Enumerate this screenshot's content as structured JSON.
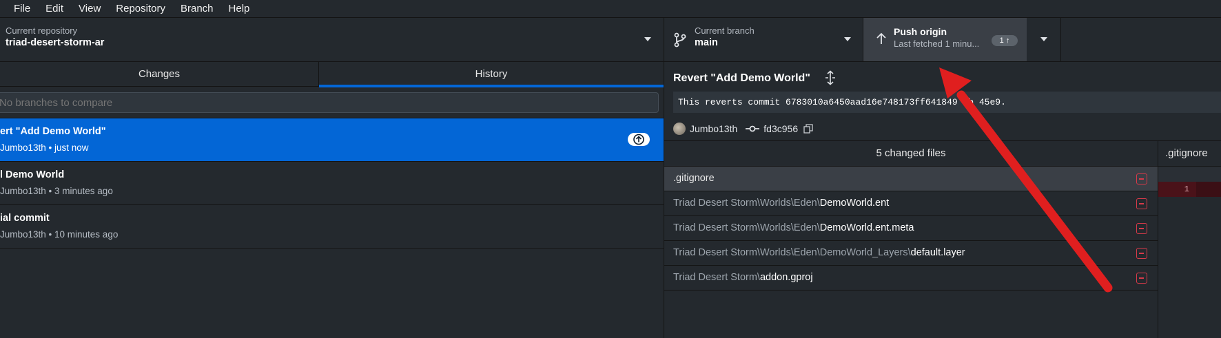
{
  "menu": {
    "items": [
      "File",
      "Edit",
      "View",
      "Repository",
      "Branch",
      "Help"
    ]
  },
  "toolbar": {
    "repo_label": "Current repository",
    "repo_name": "triad-desert-storm-ar",
    "branch_label": "Current branch",
    "branch_name": "main",
    "push_title": "Push origin",
    "push_sub": "Last fetched 1 minu...",
    "push_count": "1 ↑"
  },
  "tabs": {
    "changes": "Changes",
    "history": "History"
  },
  "compare": {
    "placeholder": "No branches to compare"
  },
  "commits": [
    {
      "title": "ert \"Add Demo World\"",
      "meta": "Jumbo13th • just now"
    },
    {
      "title": "l Demo World",
      "meta": "Jumbo13th • 3 minutes ago"
    },
    {
      "title": "ial commit",
      "meta": "Jumbo13th • 10 minutes ago"
    }
  ],
  "commit_detail": {
    "title": "Revert \"Add Demo World\"",
    "body": "This reverts commit 6783010a6450aad16e748173ff641849 6b  45e9.",
    "author": "Jumbo13th",
    "sha": "fd3c956"
  },
  "files": {
    "header": "5 changed files",
    "items": [
      {
        "dir": "",
        "name": ".gitignore"
      },
      {
        "dir": "Triad Desert Storm\\Worlds\\Eden\\",
        "name": "DemoWorld.ent"
      },
      {
        "dir": "Triad Desert Storm\\Worlds\\Eden\\",
        "name": "DemoWorld.ent.meta"
      },
      {
        "dir": "Triad Desert Storm\\Worlds\\Eden\\DemoWorld_Layers\\",
        "name": "default.layer"
      },
      {
        "dir": "Triad Desert Storm\\",
        "name": "addon.gproj"
      }
    ]
  },
  "diff": {
    "file": ".gitignore",
    "line_number": "1"
  },
  "colors": {
    "accent": "#0366d6",
    "removed": "#d73a49",
    "annotation_arrow": "#e01f1f"
  }
}
